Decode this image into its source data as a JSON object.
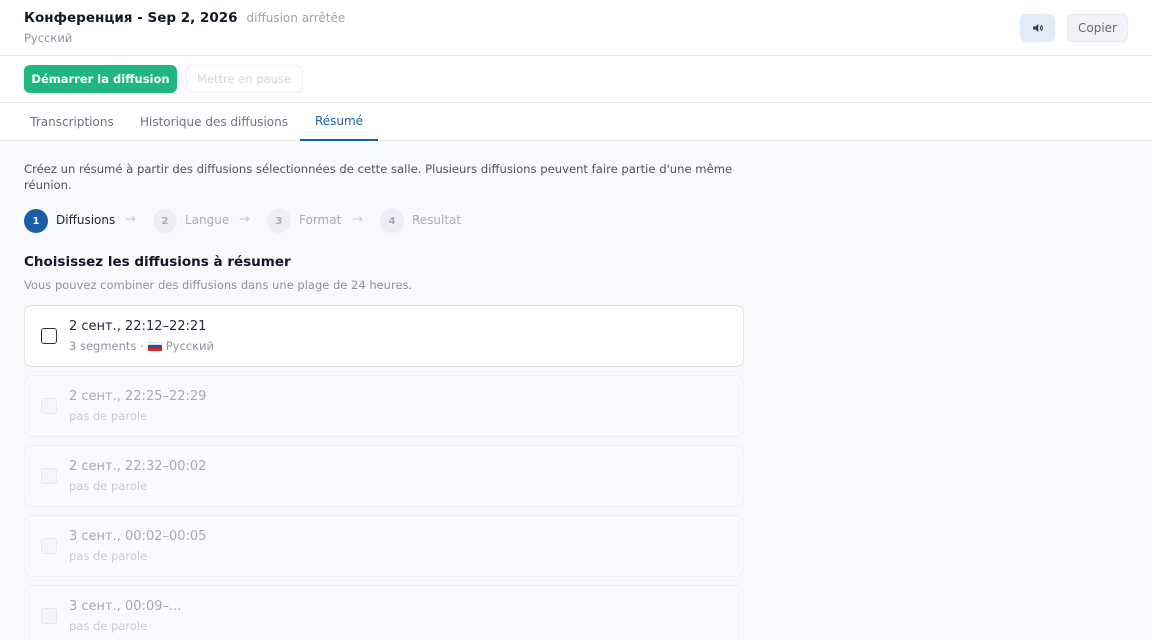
{
  "header": {
    "title": "Конференция - Sep 2, 2026",
    "status": "diffusion arrêtée",
    "language": "Русский",
    "sound_icon": "speaker-icon",
    "copy_label": "Copier"
  },
  "toolbar": {
    "start_label": "Démarrer la diffusion",
    "pause_label": "Mettre en pause"
  },
  "tabs": [
    {
      "label": "Transcriptions",
      "active": false
    },
    {
      "label": "Historique des diffusions",
      "active": false
    },
    {
      "label": "Résumé",
      "active": true
    }
  ],
  "intro": "Créez un résumé à partir des diffusions sélectionnées de cette salle. Plusieurs diffusions peuvent faire partie d'une même réunion.",
  "steps": [
    {
      "number": "1",
      "label": "Diffusions",
      "active": true
    },
    {
      "number": "2",
      "label": "Langue",
      "active": false
    },
    {
      "number": "3",
      "label": "Format",
      "active": false
    },
    {
      "number": "4",
      "label": "Resultat",
      "active": false
    }
  ],
  "step_arrow": "→",
  "section": {
    "title": "Choisissez les diffusions à résumer",
    "subtitle": "Vous pouvez combiner des diffusions dans une plage de 24 heures."
  },
  "broadcasts": [
    {
      "time": "2 сент., 22:12–22:21",
      "meta": "3 segments ·",
      "language": "Русский",
      "flag": "ru-flag-icon",
      "enabled": true,
      "checked": false
    },
    {
      "time": "2 сент., 22:25–22:29",
      "meta": "pas de parole",
      "enabled": false,
      "checked": false
    },
    {
      "time": "2 сент., 22:32–00:02",
      "meta": "pas de parole",
      "enabled": false,
      "checked": false
    },
    {
      "time": "3 сент., 00:02–00:05",
      "meta": "pas de parole",
      "enabled": false,
      "checked": false
    },
    {
      "time": "3 сент., 00:09–...",
      "meta": "pas de parole",
      "enabled": false,
      "checked": false
    }
  ],
  "colors": {
    "accent_green": "#1fb77e",
    "accent_blue": "#1c5fa8",
    "flag_ru": [
      "#ffffff",
      "#1d4fb8",
      "#d52b1e"
    ]
  }
}
